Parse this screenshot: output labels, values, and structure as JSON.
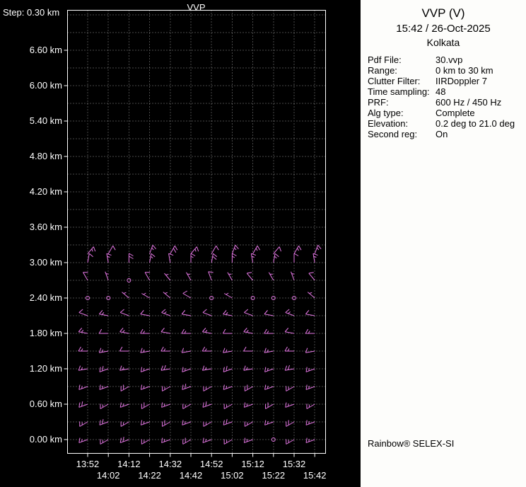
{
  "plot": {
    "title": "VVP",
    "step_label": "Step: 0.30 km",
    "y_labels": [
      "6.60 km",
      "6.00 km",
      "5.40 km",
      "4.80 km",
      "4.20 km",
      "3.60 km",
      "3.00 km",
      "2.40 km",
      "1.80 km",
      "1.20 km",
      "0.60 km",
      "0.00 km"
    ],
    "x_labels_row1": [
      "13:52",
      "14:12",
      "14:32",
      "14:52",
      "15:12",
      "15:32"
    ],
    "x_labels_row2": [
      "14:02",
      "14:22",
      "14:42",
      "15:02",
      "15:22",
      "15:42"
    ],
    "colors": {
      "background": "#000000",
      "border": "#ffffff",
      "grid": "#8f8f8f",
      "axis_text": "#ffffff",
      "barb": "#e678e6"
    }
  },
  "panel": {
    "title": "VVP (V)",
    "subtitle": "15:42 / 26-Oct-2025",
    "city": "Kolkata",
    "fields": [
      {
        "label": "Pdf File:",
        "value": "30.vvp"
      },
      {
        "label": "Range:",
        "value": "0 km to 30 km"
      },
      {
        "label": "Clutter Filter:",
        "value": "IIRDoppler 7"
      },
      {
        "label": "Time sampling:",
        "value": "48"
      },
      {
        "label": "PRF:",
        "value": "600 Hz / 450 Hz"
      },
      {
        "label": "Alg type:",
        "value": "Complete"
      },
      {
        "label": "Elevation:",
        "value": "0.2 deg to 21.0 deg"
      },
      {
        "label": "Second reg:",
        "value": "On"
      }
    ],
    "footer": "Rainbow® SELEX-SI"
  },
  "chart_data": {
    "type": "wind-barb-time-height",
    "title": "VVP",
    "x_times": [
      "13:52",
      "14:02",
      "14:12",
      "14:22",
      "14:32",
      "14:42",
      "14:52",
      "15:02",
      "15:12",
      "15:22",
      "15:32",
      "15:42"
    ],
    "y_axis_labels_km": [
      6.6,
      6.0,
      5.4,
      4.8,
      4.2,
      3.6,
      3.0,
      2.4,
      1.8,
      1.2,
      0.6,
      0.0
    ],
    "y_step_km": 0.3,
    "cell_format": "dir_deg/speed_kt | calm | empty",
    "barb_color": "#e678e6",
    "barb_rows": [
      {
        "h_km": 3.15,
        "cells": [
          "40/15",
          "30/10",
          "",
          "20/15",
          "30/20",
          "40/15",
          "30/10",
          "20/15",
          "30/15",
          "40/10",
          "30/15",
          "20/15"
        ]
      },
      {
        "h_km": 3.0,
        "cells": [
          "10/10",
          "350/15",
          "0/20",
          "10/15",
          "350/10",
          "0/15",
          "10/20",
          "0/15",
          "350/15",
          "10/15",
          "0/10",
          "350/15"
        ]
      },
      {
        "h_km": 2.7,
        "cells": [
          "330/10",
          "340/5",
          "calm",
          "330/10",
          "320/5",
          "330/5",
          "340/10",
          "330/5",
          "320/10",
          "330/5",
          "340/5",
          "320/10"
        ]
      },
      {
        "h_km": 2.4,
        "cells": [
          "calm",
          "calm",
          "310/5",
          "300/5",
          "310/5",
          "300/10",
          "calm",
          "300/5",
          "calm",
          "calm",
          "calm",
          "310/5"
        ]
      },
      {
        "h_km": 2.1,
        "cells": [
          "290/10",
          "280/15",
          "290/10",
          "280/10",
          "290/15",
          "280/10",
          "290/10",
          "280/15",
          "290/10",
          "280/10",
          "290/15",
          "280/10"
        ]
      },
      {
        "h_km": 1.8,
        "cells": [
          "280/15",
          "270/10",
          "280/15",
          "270/15",
          "280/10",
          "270/15",
          "280/15",
          "270/10",
          "280/15",
          "270/15",
          "280/10",
          "270/15"
        ]
      },
      {
        "h_km": 1.5,
        "cells": [
          "270/15",
          "260/15",
          "270/10",
          "260/15",
          "270/15",
          "260/10",
          "270/15",
          "260/15",
          "270/10",
          "260/15",
          "270/15",
          "260/10"
        ]
      },
      {
        "h_km": 1.2,
        "cells": [
          "260/15",
          "250/20",
          "260/15",
          "250/15",
          "260/20",
          "250/15",
          "260/15",
          "250/20",
          "260/15",
          "250/15",
          "260/20",
          "250/15"
        ]
      },
      {
        "h_km": 0.9,
        "cells": [
          "250/15",
          "250/15",
          "240/20",
          "250/15",
          "240/15",
          "250/20",
          "240/15",
          "250/15",
          "240/20",
          "250/15",
          "240/15",
          "250/15"
        ]
      },
      {
        "h_km": 0.6,
        "cells": [
          "250/20",
          "240/15",
          "250/15",
          "240/20",
          "250/15",
          "240/15",
          "250/20",
          "240/15",
          "250/15",
          "240/20",
          "250/15",
          "240/15"
        ]
      },
      {
        "h_km": 0.3,
        "cells": [
          "240/15",
          "250/20",
          "240/15",
          "250/15",
          "240/20",
          "250/15",
          "240/15",
          "250/20",
          "240/15",
          "250/15",
          "240/20",
          "250/15"
        ]
      },
      {
        "h_km": 0.0,
        "cells": [
          "250/15",
          "240/15",
          "250/20",
          "240/15",
          "250/15",
          "240/20",
          "250/15",
          "240/15",
          "250/15",
          "calm",
          "240/15",
          "250/15"
        ]
      }
    ]
  }
}
